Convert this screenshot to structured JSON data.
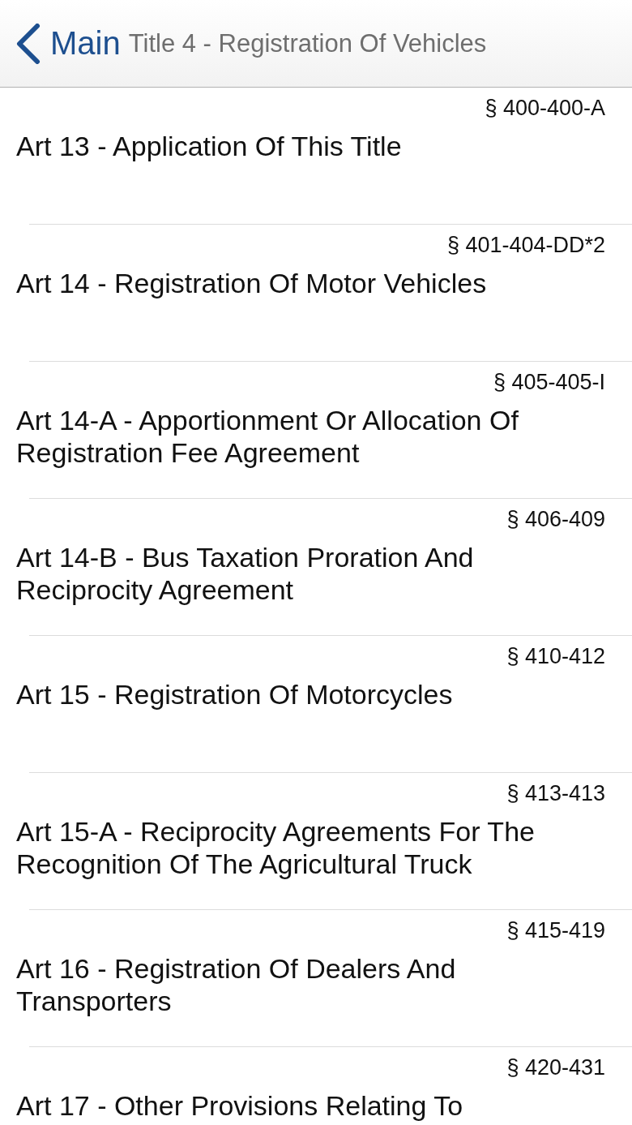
{
  "nav_bar": {
    "back_label": "Main",
    "title": "Title 4 - Registration Of Vehicles"
  },
  "articles": [
    {
      "sections": "§ 400-400-A",
      "title": "Art 13 - Application Of This Title"
    },
    {
      "sections": "§ 401-404-DD*2",
      "title": "Art 14 - Registration Of Motor Vehicles"
    },
    {
      "sections": "§ 405-405-I",
      "title": "Art 14-A - Apportionment Or Allocation Of Registration Fee Agreement"
    },
    {
      "sections": "§ 406-409",
      "title": "Art 14-B - Bus Taxation Proration And Reciprocity Agreement"
    },
    {
      "sections": "§ 410-412",
      "title": "Art 15 - Registration Of Motorcycles"
    },
    {
      "sections": "§ 413-413",
      "title": "Art 15-A - Reciprocity Agreements For The Recognition Of The Agricultural Truck"
    },
    {
      "sections": "§ 415-419",
      "title": "Art 16 - Registration Of Dealers And Transporters"
    },
    {
      "sections": "§ 420-431",
      "title": "Art 17 - Other Provisions Relating To"
    }
  ]
}
